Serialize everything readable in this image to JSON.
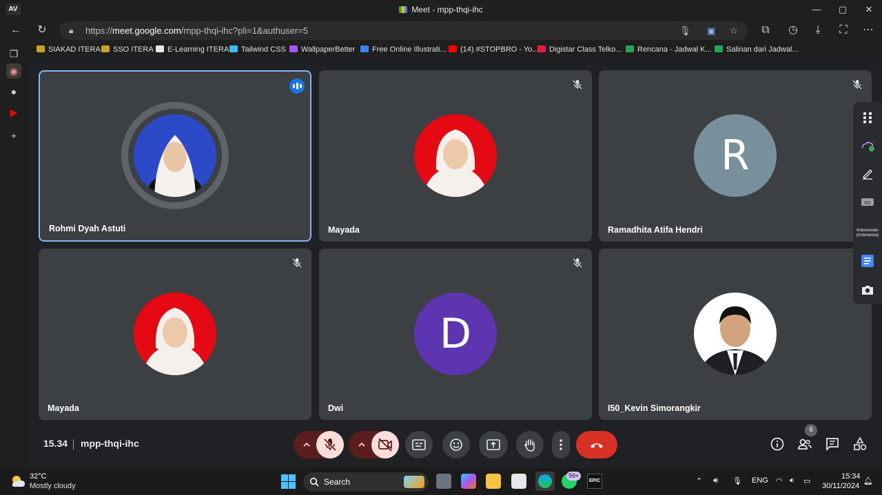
{
  "browser": {
    "logo": "AV",
    "window_title": "Meet - mpp-thqi-ihc",
    "url_prefix": "https://",
    "url_host": "meet.google.com",
    "url_path": "/mpp-thqi-ihc?pli=1&authuser=5"
  },
  "bookmarks": [
    {
      "label": "SIAKAD ITERA",
      "color": "#c9a227"
    },
    {
      "label": "SSO ITERA",
      "color": "#c9a227"
    },
    {
      "label": "E-Learning ITERA",
      "color": "#e8e8e8"
    },
    {
      "label": "Tailwind CSS",
      "color": "#38bdf8"
    },
    {
      "label": "WallpaperBetter",
      "color": "#a855f7"
    },
    {
      "label": "Free Online Illustrati...",
      "color": "#3b82f6"
    },
    {
      "label": "(14) #STOPBRO - Yo...",
      "color": "#ff0000"
    },
    {
      "label": "Digistar Class Telko...",
      "color": "#e11d48"
    },
    {
      "label": "Rencana - Jadwal K...",
      "color": "#22a55a"
    },
    {
      "label": "Salinan dari Jadwal...",
      "color": "#22a55a"
    }
  ],
  "participants": [
    {
      "name": "Rohmi Dyah Astuti",
      "avatar": "photo",
      "bg": "#2c49c8",
      "speaking": true,
      "muted": false
    },
    {
      "name": "Mayada",
      "avatar": "photo",
      "bg": "#e50914",
      "speaking": false,
      "muted": true
    },
    {
      "name": "Ramadhita Atifa Hendri",
      "avatar": "letter",
      "letter": "R",
      "bg": "#78909c",
      "speaking": false,
      "muted": true
    },
    {
      "name": "Mayada",
      "avatar": "photo",
      "bg": "#e50914",
      "speaking": false,
      "muted": true
    },
    {
      "name": "Dwi",
      "avatar": "letter",
      "letter": "D",
      "bg": "#5e35b1",
      "speaking": false,
      "muted": true
    },
    {
      "name": "I50_Kevin Simorangkir",
      "avatar": "photo",
      "bg": "#ffffff",
      "speaking": false,
      "muted": false
    }
  ],
  "side_panel": {
    "language_label": "Indonesian (Indonesia)",
    "icons": [
      "apps-grid-icon",
      "weather-icon",
      "draw-icon",
      "captions-icon",
      "notes-icon",
      "camera-icon"
    ]
  },
  "meeting": {
    "time": "15.34",
    "code": "mpp-thqi-ihc",
    "people_count": "6"
  },
  "taskbar": {
    "temperature": "32°C",
    "weather": "Mostly cloudy",
    "search_label": "Search",
    "whatsapp_badge": "99+",
    "epic_label": "EPIC",
    "language": "ENG",
    "time": "15:34",
    "date": "30/11/2024"
  }
}
